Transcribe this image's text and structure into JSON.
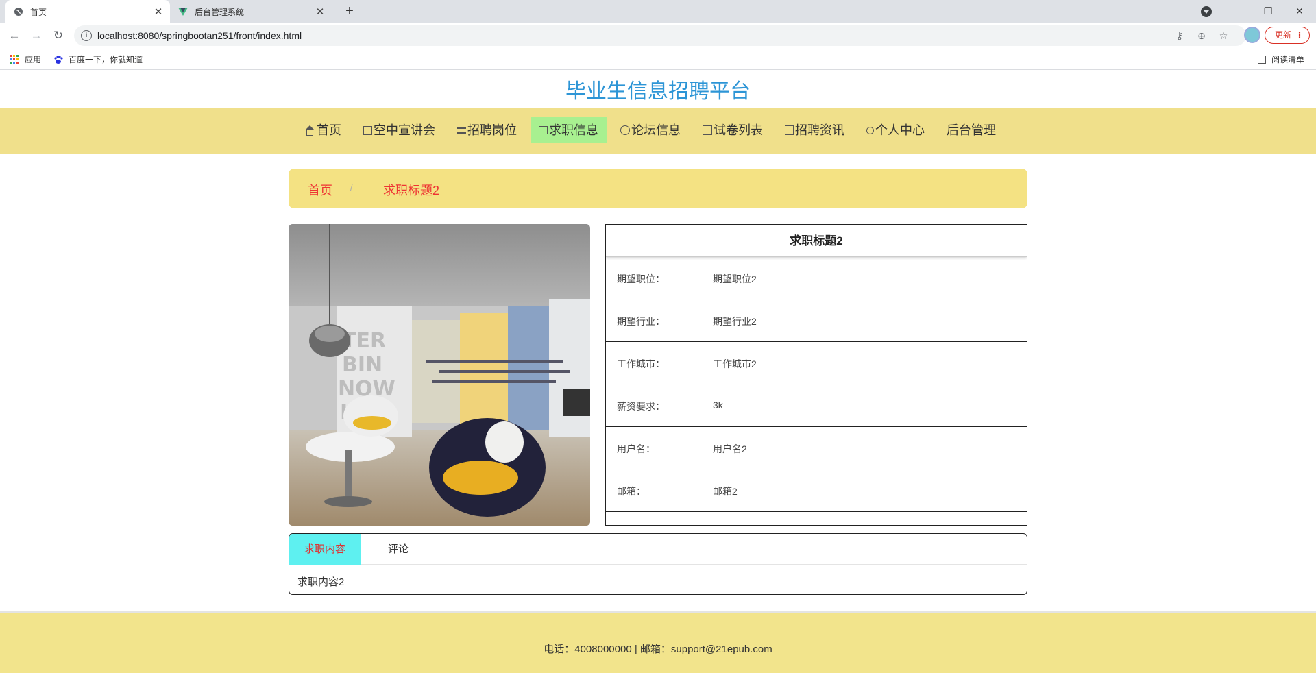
{
  "browser": {
    "tabs": [
      {
        "label": "首页",
        "active": true,
        "icon": "globe-icon"
      },
      {
        "label": "后台管理系统",
        "active": false,
        "icon": "vue-logo-icon"
      }
    ],
    "new_tab": "+",
    "url": "localhost:8080/springbootan251/front/index.html",
    "update_label": "更新",
    "bookmarks": [
      {
        "label": "应用",
        "icon": "apps-grid-icon"
      },
      {
        "label": "百度一下，你就知道",
        "icon": "baidu-paw-icon"
      }
    ],
    "reading_list": "阅读清单"
  },
  "site": {
    "title": "毕业生信息招聘平台"
  },
  "nav": {
    "items": [
      {
        "label": "首页",
        "icon": "home-icon",
        "active": false
      },
      {
        "label": "空中宣讲会",
        "icon": "grid-icon",
        "active": false
      },
      {
        "label": "招聘岗位",
        "icon": "sliders-icon",
        "active": false
      },
      {
        "label": "求职信息",
        "icon": "gift-icon",
        "active": true
      },
      {
        "label": "论坛信息",
        "icon": "circle-icon",
        "active": false
      },
      {
        "label": "试卷列表",
        "icon": "grid-plus-icon",
        "active": false
      },
      {
        "label": "招聘资讯",
        "icon": "document-icon",
        "active": false
      },
      {
        "label": "个人中心",
        "icon": "user-icon",
        "active": false
      },
      {
        "label": "后台管理",
        "icon": "",
        "active": false
      }
    ]
  },
  "breadcrumb": {
    "home": "首页",
    "separator": "/",
    "current": "求职标题2"
  },
  "detail": {
    "title": "求职标题2",
    "rows": [
      {
        "label": "期望职位：",
        "value": "期望职位2"
      },
      {
        "label": "期望行业：",
        "value": "期望行业2"
      },
      {
        "label": "工作城市：",
        "value": "工作城市2"
      },
      {
        "label": "薪资要求：",
        "value": "3k"
      },
      {
        "label": "用户名：",
        "value": "用户名2"
      },
      {
        "label": "邮箱：",
        "value": "邮箱2"
      }
    ]
  },
  "content_tabs": {
    "tabs": [
      "求职内容",
      "评论"
    ],
    "active_content": "求职内容2"
  },
  "footer": {
    "text": "电话：4008000000 | 邮箱：support@21epub.com"
  },
  "colors": {
    "title_blue": "#2d95d6",
    "nav_bg": "#f0e08b",
    "nav_active": "#a8f090",
    "breadcrumb_bg": "#f4e283",
    "breadcrumb_text": "#ee3333",
    "tab_active_bg": "#5ef0f0",
    "footer_bg": "#f2e48c"
  }
}
